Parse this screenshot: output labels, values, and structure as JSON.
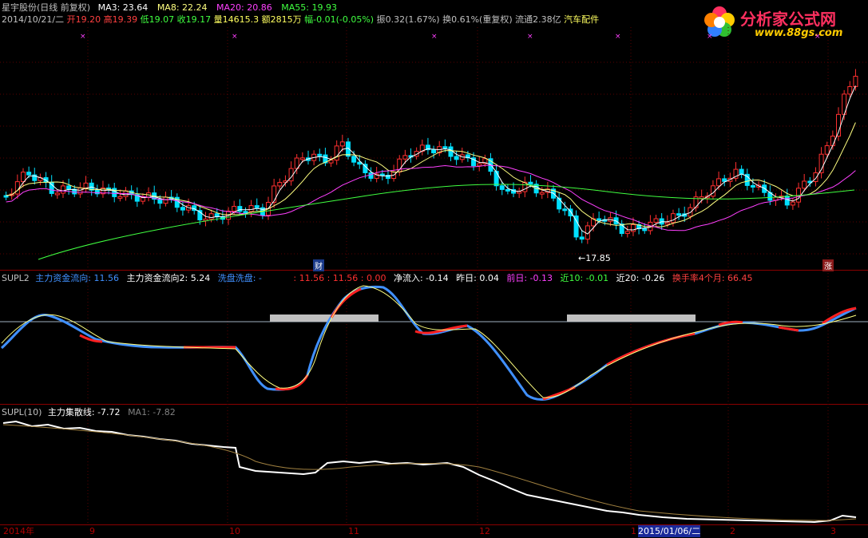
{
  "header": {
    "stock": "星宇股份(日线 前复权)",
    "ma3": "MA3: 23.64",
    "ma8": "MA8: 22.24",
    "ma20": "MA20: 20.86",
    "ma55": "MA55: 19.93",
    "row2": {
      "date": "2014/10/21/二",
      "open": "开19.20",
      "high": "高19.39",
      "low": "低19.07",
      "close": "收19.17",
      "volume": "量14615.3",
      "amount": "额2815万",
      "change": "幅-0.01(-0.05%)",
      "amplitude": "振0.32(1.67%)",
      "turnover": "换0.61%(重复权)",
      "float": "流通2.38亿",
      "sector": "汽车配件"
    }
  },
  "logo": {
    "text": "分析家公式网",
    "url": "www.88gs.com"
  },
  "price_panel": {
    "low_label": "←17.85",
    "marker_left": "财",
    "marker_right": "涨"
  },
  "mid_panel": {
    "name": "SUPL2",
    "flow1": "主力资金流向: 11.56",
    "flow2": "主力资金流向2: 5.24",
    "wash": "洗盘洗盘: -",
    "vals": ": 11.56 : 11.56 : 0.00",
    "net": "净流入: -0.14",
    "yday": "昨日: 0.04",
    "prev": "前日: -0.13",
    "near10": "近10: -0.01",
    "near20": "近20: -0.26",
    "turnover4m": "换手率4个月: 66.45"
  },
  "bottom_panel": {
    "name": "SUPL(10)",
    "line": "主力集散线: -7.72",
    "ma1": "MA1: -7.82"
  },
  "xaxis": {
    "ticks": [
      "2014年",
      "9",
      "10",
      "11",
      "12",
      "1",
      "2015/01/06/二",
      "2",
      "3"
    ]
  },
  "colors": {
    "up": "#ff3030",
    "down": "#00e0ff",
    "ma3": "#ffffff",
    "ma8": "#ffff80",
    "ma20": "#ff40ff",
    "ma55": "#40ff40",
    "grid": "#8b0000"
  },
  "chart_data": {
    "type": "line",
    "title": "星宇股份(日线 前复权)",
    "series": [
      {
        "name": "MA3",
        "values": [
          23.64
        ]
      },
      {
        "name": "MA8",
        "values": [
          22.24
        ]
      },
      {
        "name": "MA20",
        "values": [
          20.86
        ]
      },
      {
        "name": "MA55",
        "values": [
          19.93
        ]
      },
      {
        "name": "主力资金流向",
        "values": [
          11.56
        ]
      },
      {
        "name": "主力资金流向2",
        "values": [
          5.24
        ]
      },
      {
        "name": "主力集散线",
        "values": [
          -7.72
        ]
      },
      {
        "name": "MA1",
        "values": [
          -7.82
        ]
      }
    ],
    "annotations": [
      "←17.85"
    ],
    "price_low": 17.85,
    "xlabel": "",
    "ylabel": ""
  }
}
